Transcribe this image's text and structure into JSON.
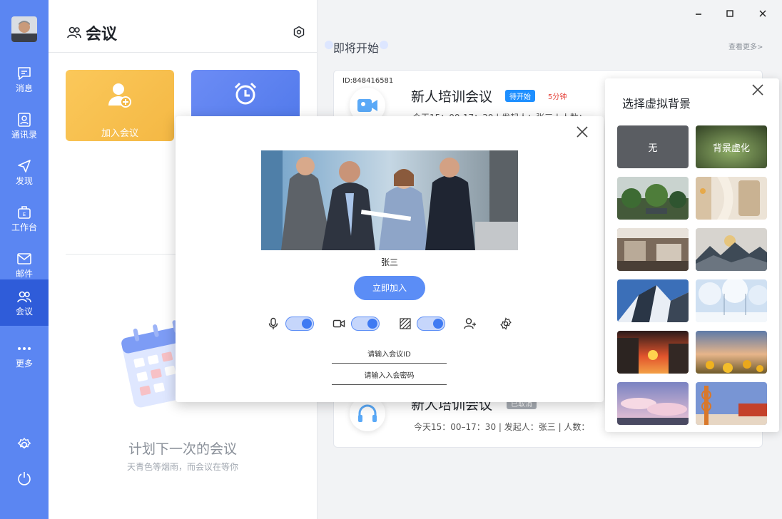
{
  "colors": {
    "rail": "#5b86f2",
    "rail_active": "#2f5cd9",
    "primary": "#5b8df6",
    "badge_pending": "#1e8fff",
    "badge_canceled": "#a7acb3",
    "remain_red": "#e5423a"
  },
  "rail": {
    "items": [
      {
        "label": "消息",
        "icon": "chat-icon"
      },
      {
        "label": "通讯录",
        "icon": "contacts-icon"
      },
      {
        "label": "发现",
        "icon": "send-icon"
      },
      {
        "label": "工作台",
        "icon": "briefcase-icon"
      },
      {
        "label": "邮件",
        "icon": "mail-icon"
      },
      {
        "label": "会议",
        "icon": "meeting-icon"
      },
      {
        "label": "更多",
        "icon": "more-icon"
      }
    ],
    "active_item": "会议"
  },
  "mid": {
    "title": "会议",
    "join_card_label": "加入会议",
    "plan_title": "计划下一次的会议",
    "plan_sub": "天青色等烟雨，而会议在等你"
  },
  "main": {
    "upcoming_title": "即将开始",
    "see_more": "查看更多>",
    "meeting_id": "ID:848416581",
    "meeting1": {
      "title": "新人培训会议",
      "badge": "待开始",
      "remain": "5分钟",
      "info": "今天15：00-17：30  |  发起人：张三  |  人数："
    },
    "meeting2": {
      "title": "新人培训会议",
      "badge": "已取消",
      "info": "今天15：00–17：30   |   发起人：张三   |   人数："
    }
  },
  "join_modal": {
    "user_name": "张三",
    "join_button": "立即加入",
    "meeting_id_placeholder": "请输入会议ID",
    "password_placeholder": "请输入入会密码",
    "toggles": {
      "mic": true,
      "camera": true,
      "background": true
    }
  },
  "vbg": {
    "title": "选择虚拟背景",
    "options": [
      {
        "label": "无",
        "icon": "none"
      },
      {
        "label": "背景虚化",
        "icon": "blur"
      },
      {
        "label": "",
        "icon": "garden"
      },
      {
        "label": "",
        "icon": "interior"
      },
      {
        "label": "",
        "icon": "office"
      },
      {
        "label": "",
        "icon": "moon-mountains"
      },
      {
        "label": "",
        "icon": "snow-mountain"
      },
      {
        "label": "",
        "icon": "snow-forest"
      },
      {
        "label": "",
        "icon": "city-sunset"
      },
      {
        "label": "",
        "icon": "sunflowers"
      },
      {
        "label": "",
        "icon": "pink-clouds"
      },
      {
        "label": "",
        "icon": "tower"
      }
    ]
  }
}
